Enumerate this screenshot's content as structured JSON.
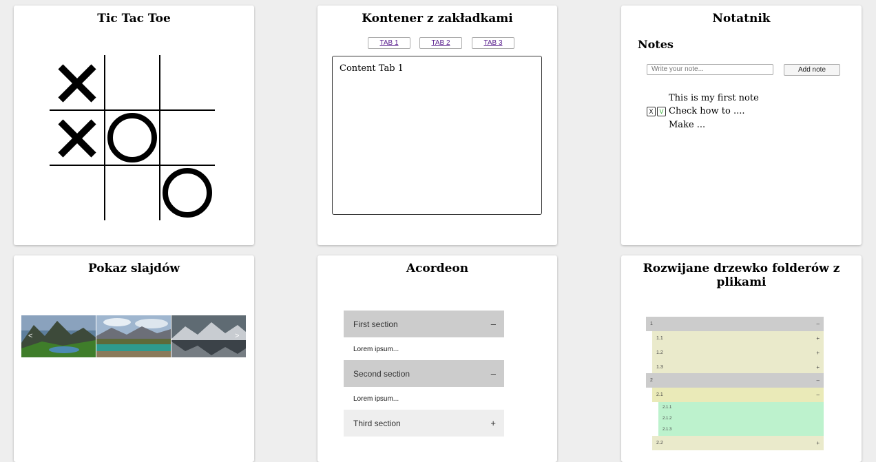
{
  "tictactoe": {
    "title": "Tic Tac Toe",
    "board": [
      "X",
      "",
      "",
      "X",
      "O",
      "",
      "",
      "",
      "O"
    ]
  },
  "tabs_widget": {
    "title": "Kontener z zakładkami",
    "tabs": [
      "TAB 1",
      "TAB 2",
      "TAB 3"
    ],
    "content": "Content Tab 1"
  },
  "notebook": {
    "title": "Notatnik",
    "heading": "Notes",
    "input_placeholder": "Write your note...",
    "add_label": "Add note",
    "notes": [
      "This is my first note",
      "Check how to ....",
      "Make ..."
    ],
    "delete_label": "X",
    "done_label": "V"
  },
  "slideshow": {
    "title": "Pokaz slajdów",
    "prev_label": "<",
    "next_label": ">"
  },
  "accordion": {
    "title": "Acordeon",
    "sections": [
      {
        "label": "First section",
        "sign": "–",
        "body": "Lorem ipsum..."
      },
      {
        "label": "Second section",
        "sign": "–",
        "body": "Lorem ipsum..."
      },
      {
        "label": "Third section",
        "sign": "+"
      }
    ]
  },
  "tree": {
    "title": "Rozwijane drzewko folderów z plikami",
    "rows": [
      {
        "label": "1",
        "sign": "–"
      },
      {
        "label": "1.1",
        "sign": "+"
      },
      {
        "label": "1.2",
        "sign": "+"
      },
      {
        "label": "1.3",
        "sign": "+"
      },
      {
        "label": "2",
        "sign": "–"
      },
      {
        "label": "2.1",
        "sign": "–"
      },
      {
        "label": "2.1.1",
        "sign": ""
      },
      {
        "label": "2.1.2",
        "sign": ""
      },
      {
        "label": "2.1.3",
        "sign": ""
      },
      {
        "label": "2.2",
        "sign": "+"
      }
    ]
  }
}
